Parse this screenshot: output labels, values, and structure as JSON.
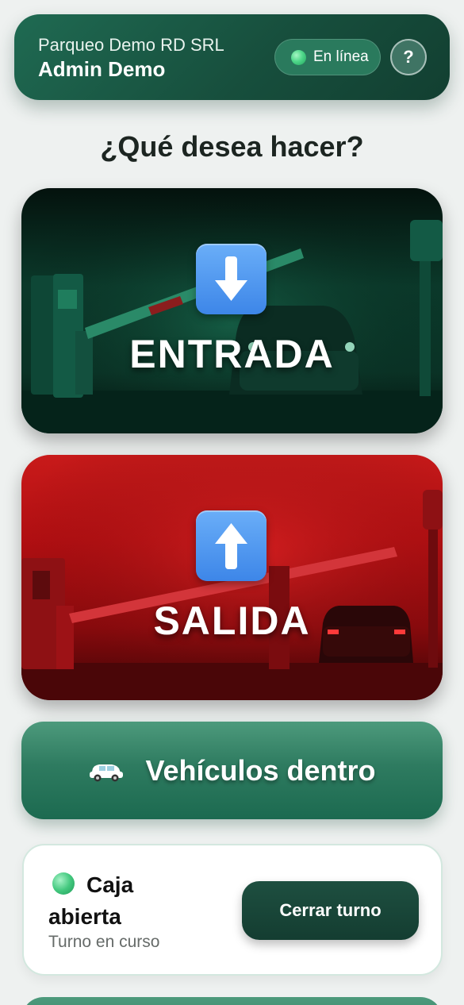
{
  "header": {
    "company": "Parqueo Demo RD SRL",
    "user": "Admin Demo",
    "status_label": "En línea",
    "help_label": "?"
  },
  "question": "¿Qué desea hacer?",
  "actions": {
    "entrada": {
      "label": "ENTRADA",
      "icon": "arrow-down-icon",
      "color": "#0b3a2b"
    },
    "salida": {
      "label": "SALIDA",
      "icon": "arrow-up-icon",
      "color": "#b40f12"
    }
  },
  "vehicles": {
    "label": "Vehículos dentro",
    "icon": "car-icon"
  },
  "cash": {
    "title": "Caja abierta",
    "subtitle": "Turno en curso",
    "button_label": "Cerrar turno",
    "status_color": "#44c97f"
  },
  "colors": {
    "brand_green": "#174f3d",
    "accent_green": "#2e7b60",
    "exit_red": "#b40f12",
    "arrow_blue": "#3d86e8"
  }
}
